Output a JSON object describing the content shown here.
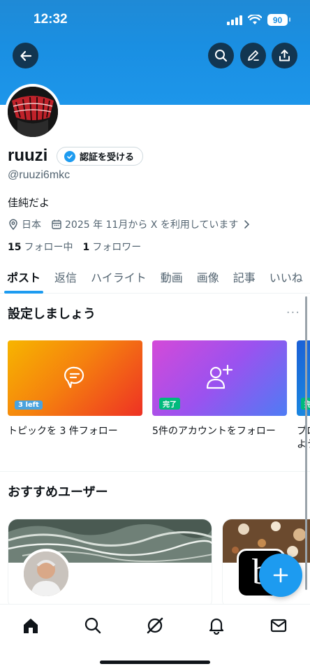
{
  "status_bar": {
    "time": "12:32",
    "battery": "90"
  },
  "header": {
    "back_icon": "arrow-left-icon",
    "actions": [
      "search-icon",
      "edit-icon",
      "share-icon"
    ]
  },
  "profile": {
    "name": "ruuzi",
    "verify_label": "認証を受ける",
    "handle": "@ruuzi6mkc",
    "bio": "佳純だよ",
    "location": "日本",
    "joined": "2025 年 11月から X を利用しています",
    "following_count": "15",
    "following_label": "フォロー中",
    "followers_count": "1",
    "followers_label": "フォロワー"
  },
  "tabs": [
    {
      "label": "ポスト",
      "active": true
    },
    {
      "label": "返信"
    },
    {
      "label": "ハイライト"
    },
    {
      "label": "動画"
    },
    {
      "label": "画像"
    },
    {
      "label": "記事"
    },
    {
      "label": "いいね"
    }
  ],
  "setup": {
    "title": "設定しましょう",
    "more": "···",
    "cards": [
      {
        "badge": "3 left",
        "label": "トピックを 3 件フォロー",
        "icon": "chat-bubble-icon"
      },
      {
        "badge": "完了",
        "label": "5件のアカウントをフォロー",
        "icon": "person-add-icon"
      },
      {
        "badge": "完",
        "label": "プロ",
        "label2": "よう"
      }
    ]
  },
  "recommended": {
    "title": "おすすめユーザー"
  },
  "bottom_nav": [
    "home-icon",
    "search-icon",
    "grok-icon",
    "bell-icon",
    "mail-icon"
  ],
  "colors": {
    "accent": "#1d9bf0",
    "banner": "#1a8fe2",
    "text": "#0f1419",
    "muted": "#536471"
  }
}
